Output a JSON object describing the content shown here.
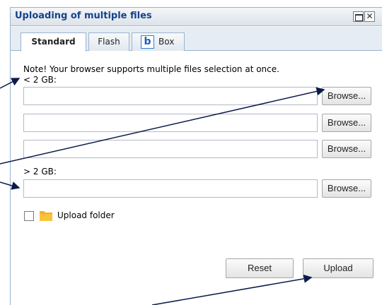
{
  "window": {
    "title": "Uploading of multiple files",
    "close_glyph": "✕"
  },
  "tabs": [
    {
      "label": "Standard",
      "active": true
    },
    {
      "label": "Flash",
      "active": false
    },
    {
      "label": "Box",
      "active": false,
      "logo_letter": "b"
    }
  ],
  "main": {
    "note": "Note! Your browser supports multiple files selection at once.",
    "small_files_label": "< 2 GB:",
    "large_files_label": "> 2 GB:",
    "file_inputs": [
      {
        "value": "",
        "browse_label": "Browse..."
      },
      {
        "value": "",
        "browse_label": "Browse..."
      },
      {
        "value": "",
        "browse_label": "Browse..."
      },
      {
        "value": "",
        "browse_label": "Browse..."
      }
    ],
    "upload_folder_label": "Upload folder",
    "upload_folder_checked": false
  },
  "footer": {
    "reset_label": "Reset",
    "upload_label": "Upload"
  },
  "icons": [
    "maximize-icon",
    "close-icon",
    "box-logo-icon",
    "folder-icon",
    "annotation-arrows"
  ],
  "colors": {
    "title_text": "#15428b",
    "panel_border": "#99b4d1",
    "arrow": "#0b1a4a",
    "folder": "#f5b21b"
  }
}
